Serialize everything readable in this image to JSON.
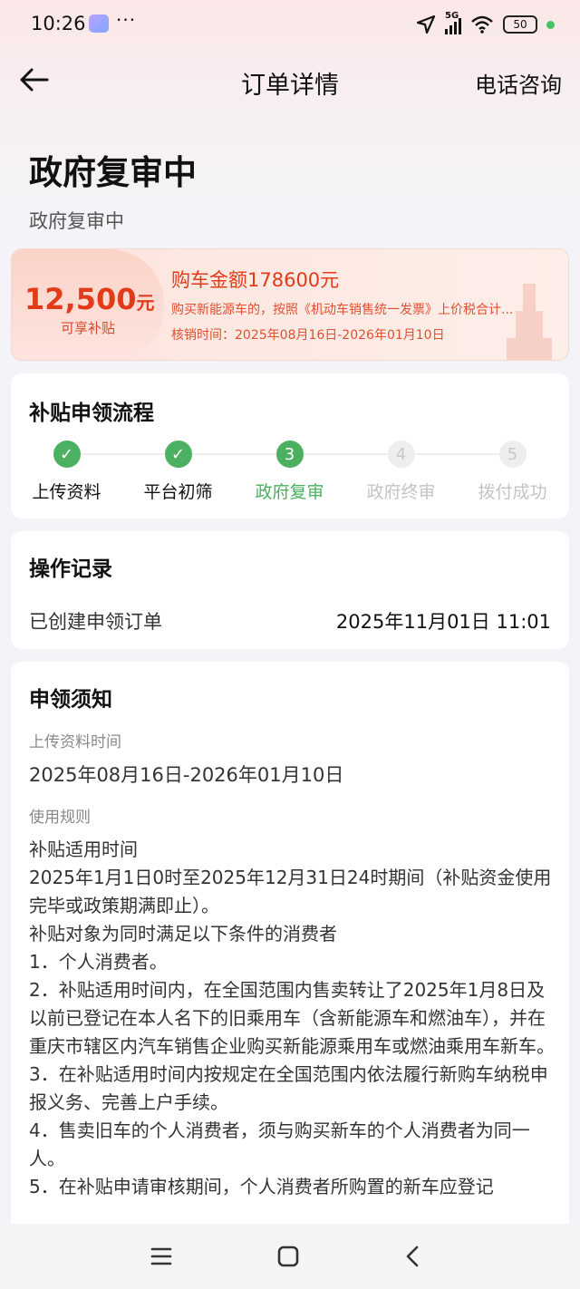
{
  "status_bar": {
    "time": "10:26",
    "dots": "···",
    "network": "5G",
    "battery": "50"
  },
  "nav": {
    "title": "订单详情",
    "phone": "电话咨询"
  },
  "order_status": {
    "title": "政府复审中",
    "subtitle": "政府复审中"
  },
  "subsidy": {
    "amount": "12,500",
    "unit": "元",
    "label": "可享补贴",
    "car_amount": "购车金额178600元",
    "description": "购买新能源车的，按照《机动车销售统一发票》上价税合计...",
    "period": "核销时间：2025年08月16日-2026年01月10日"
  },
  "process": {
    "title": "补贴申领流程",
    "steps": [
      {
        "num": "✓",
        "label": "上传资料",
        "state": "done"
      },
      {
        "num": "✓",
        "label": "平台初筛",
        "state": "done"
      },
      {
        "num": "3",
        "label": "政府复审",
        "state": "current"
      },
      {
        "num": "4",
        "label": "政府终审",
        "state": "todo"
      },
      {
        "num": "5",
        "label": "拨付成功",
        "state": "todo"
      }
    ]
  },
  "records": {
    "title": "操作记录",
    "items": [
      {
        "label": "已创建申领订单",
        "time": "2025年11月01日 11:01"
      }
    ]
  },
  "notice": {
    "title": "申领须知",
    "upload_label": "上传资料时间",
    "upload_value": "2025年08月16日-2026年01月10日",
    "rules_label": "使用规则",
    "rules": [
      "补贴适用时间",
      "2025年1月1日0时至2025年12月31日24时期间（补贴资金使用完毕或政策期满即止）。",
      "补贴对象为同时满足以下条件的消费者",
      "1．个人消费者。",
      "2．补贴适用时间内，在全国范围内售卖转让了2025年1月8日及以前已登记在本人名下的旧乘用车（含新能源车和燃油车），并在重庆市辖区内汽车销售企业购买新能源乘用车或燃油乘用车新车。",
      "3．在补贴适用时间内按规定在全国范围内依法履行新购车纳税申报义务、完善上户手续。",
      "4．售卖旧车的个人消费者，须与购买新车的个人消费者为同一人。",
      "5．在补贴申请审核期间，个人消费者所购置的新车应登记"
    ]
  },
  "bottom_nav": {
    "menu": "menu-icon",
    "home": "home-icon",
    "back": "back-icon"
  }
}
